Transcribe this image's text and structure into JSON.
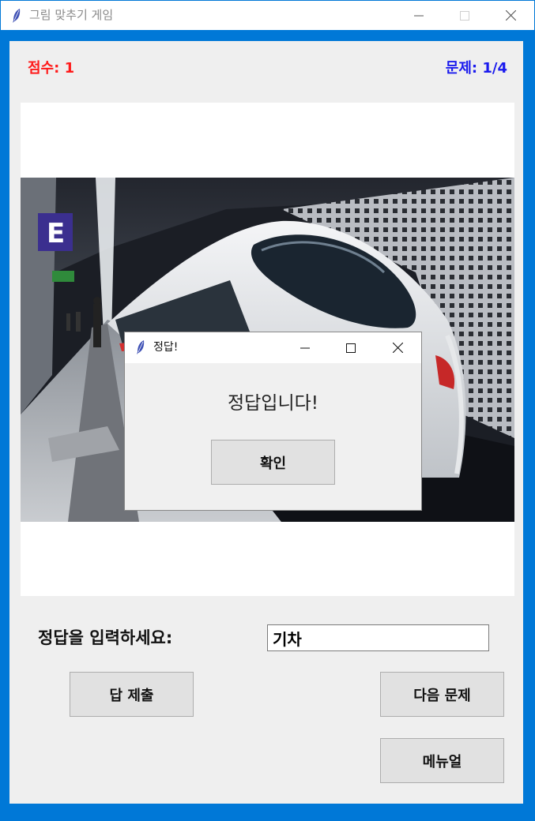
{
  "window": {
    "title": "그림 맞추기 게임",
    "accent_color": "#0078d7"
  },
  "header": {
    "score": "점수: 1",
    "question": "문제: 1/4",
    "score_color": "#ff1a1a",
    "question_color": "#1a1aee"
  },
  "image": {
    "description_icon": "train-photo",
    "sign_letter": "E"
  },
  "answer": {
    "label": "정답을 입력하세요:",
    "value": "기차"
  },
  "buttons": {
    "submit": "답 제출",
    "next": "다음 문제",
    "manual": "메뉴얼"
  },
  "dialog": {
    "title": "정답!",
    "message": "정답입니다!",
    "ok": "확인"
  }
}
